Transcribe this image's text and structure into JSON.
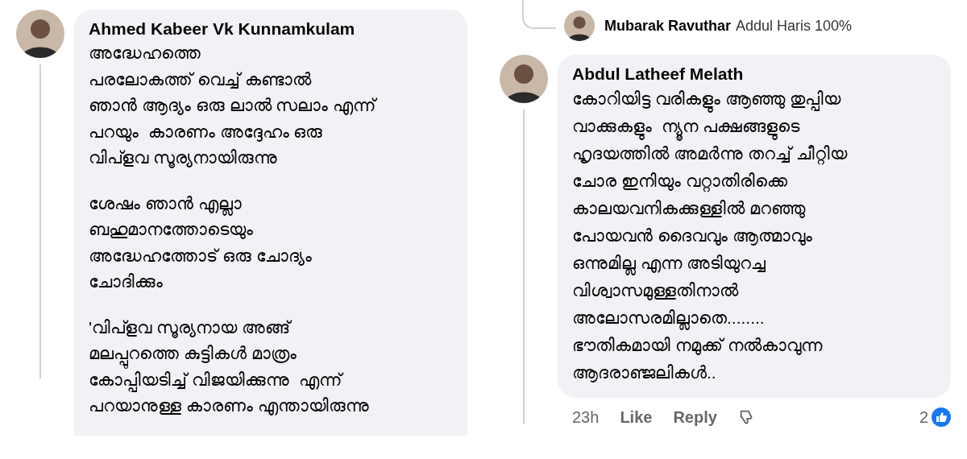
{
  "left_comment": {
    "author": "Ahmed Kabeer Vk Kunnamkulam",
    "paragraphs": [
      [
        "അദ്ധേഹത്തെ",
        "പരലോകത്ത് വെച്ച് കണ്ടാൽ",
        "ഞാൻ ആദ്യം ഒരു ലാൽ സലാം എന്ന്",
        "പറയും  കാരണം അദ്ദേഹം ഒരു",
        "വിപ്ളവ സൂര്യനായിരുന്നു"
      ],
      [
        "ശേഷം ഞാൻ എല്ലാ",
        "ബഹുമാനത്തോടെയും",
        "അദ്ധേഹത്തോട് ഒരു ചോദ്യം",
        "ചോദിക്കും"
      ],
      [
        "'വിപ്ളവ സൂര്യനായ അങ്ങ്",
        "മലപ്പുറത്തെ കുട്ടികൾ മാത്രം",
        "കോപ്പിയടിച്ച് വിജയിക്കുന്നു  എന്ന്",
        "പറയാനുള്ള കാരണം എന്തായിരുന്നു"
      ]
    ]
  },
  "right_thread": {
    "reply": {
      "author": "Mubarak Ravuthar",
      "text": "Addul Haris 100%"
    },
    "comment": {
      "author": "Abdul Latheef Melath",
      "paragraphs": [
        [
          "കോറിയിട്ട വരികളും ആഞ്ഞു തുപ്പിയ",
          "വാക്കുകളും  ന്യൂന പക്ഷങ്ങളുടെ",
          "ഹൃദയത്തിൽ അമർന്നു തറച്ച് ചീറ്റിയ",
          "ചോര ഇനിയും വറ്റാതിരിക്കെ",
          "കാലയവനികക്കുള്ളിൽ മറഞ്ഞു",
          "പോയവൻ ദൈവവും ആത്മാവും",
          "ഒന്നുമില്ല എന്ന അടിയുറച്ച",
          "വിശ്വാസമുള്ളതിനാൽ",
          "അലോസരമില്ലാതെ........",
          "ഭൗതികമായി നമുക്ക് നൽകാവുന്ന",
          "ആദരാഞ്ജലികൾ.."
        ]
      ],
      "time": "23h",
      "actions": [
        "Like",
        "Reply"
      ],
      "reaction_count": "2"
    }
  }
}
